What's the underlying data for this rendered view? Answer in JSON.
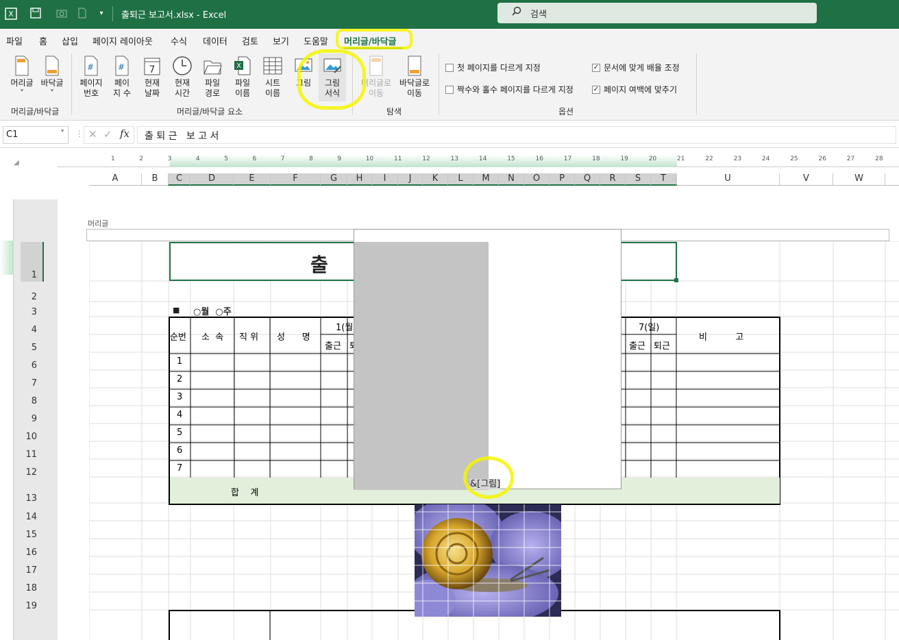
{
  "app": {
    "title": "출퇴근 보고서.xlsx  -  Excel",
    "search_placeholder": "검색"
  },
  "tabs": [
    "파일",
    "홈",
    "삽입",
    "페이지 레이아웃",
    "수식",
    "데이터",
    "검토",
    "보기",
    "도움말",
    "머리글/바닥글"
  ],
  "active_tab": "머리글/바닥글",
  "ribbon": {
    "buttons": [
      {
        "label1": "머리글",
        "label2": "˅"
      },
      {
        "label1": "바닥글",
        "label2": "˅"
      },
      {
        "label1": "페이지",
        "label2": "번호"
      },
      {
        "label1": "페이",
        "label2": "지 수"
      },
      {
        "label1": "현재",
        "label2": "날짜"
      },
      {
        "label1": "현재",
        "label2": "시간"
      },
      {
        "label1": "파일",
        "label2": "경로"
      },
      {
        "label1": "파일",
        "label2": "이름"
      },
      {
        "label1": "시트",
        "label2": "이름"
      },
      {
        "label1": "그림",
        "label2": ""
      },
      {
        "label1": "그림",
        "label2": "서식"
      },
      {
        "label1": "머리글로",
        "label2": "이동"
      },
      {
        "label1": "바닥글로",
        "label2": "이동"
      }
    ],
    "groups": [
      "머리글/바닥글",
      "머리글/바닥글 요소",
      "탐색",
      "옵션"
    ],
    "options": [
      {
        "label": "첫 페이지를 다르게 지정",
        "checked": false
      },
      {
        "label": "짝수와 홀수 페이지를 다르게 지정",
        "checked": false
      },
      {
        "label": "문서에 맞게 배율 조정",
        "checked": true
      },
      {
        "label": "페이지 여백에 맞추기",
        "checked": true
      }
    ]
  },
  "formula_bar": {
    "name_box": "C1",
    "formula": "출 퇴 근   보 고 서"
  },
  "columns": [
    "A",
    "B",
    "C",
    "D",
    "E",
    "F",
    "G",
    "H",
    "I",
    "J",
    "K",
    "L",
    "M",
    "N",
    "O",
    "P",
    "Q",
    "R",
    "S",
    "T",
    "U",
    "V",
    "W"
  ],
  "ruler_numbers": [
    "1",
    "2",
    "3",
    "4",
    "5",
    "6",
    "7",
    "8",
    "9",
    "10",
    "11",
    "12",
    "13",
    "14",
    "15",
    "16",
    "17",
    "18",
    "19",
    "20",
    "21",
    "22",
    "23",
    "24",
    "25",
    "26",
    "27",
    "28"
  ],
  "rows": [
    "1",
    "2",
    "3",
    "4",
    "5",
    "6",
    "7",
    "8",
    "9",
    "10",
    "11",
    "12",
    "13",
    "14",
    "15",
    "16",
    "17",
    "18",
    "19"
  ],
  "header_label": "머리글",
  "sheet": {
    "title_visible": "출  퇴",
    "period_mark": "■",
    "period_text": "○월  ○주",
    "col_no": "순번",
    "col_dept": "소  속",
    "col_rank": "직 위",
    "col_name": "성      명",
    "day1": "1(월",
    "day7": "7(일)",
    "in": "출근",
    "out": "퇴근",
    "out_short": "퇴",
    "remark": "비          고",
    "numbers": [
      "1",
      "2",
      "3",
      "4",
      "5",
      "6",
      "7"
    ],
    "total": "합    계"
  },
  "header_code": "&[그림]"
}
